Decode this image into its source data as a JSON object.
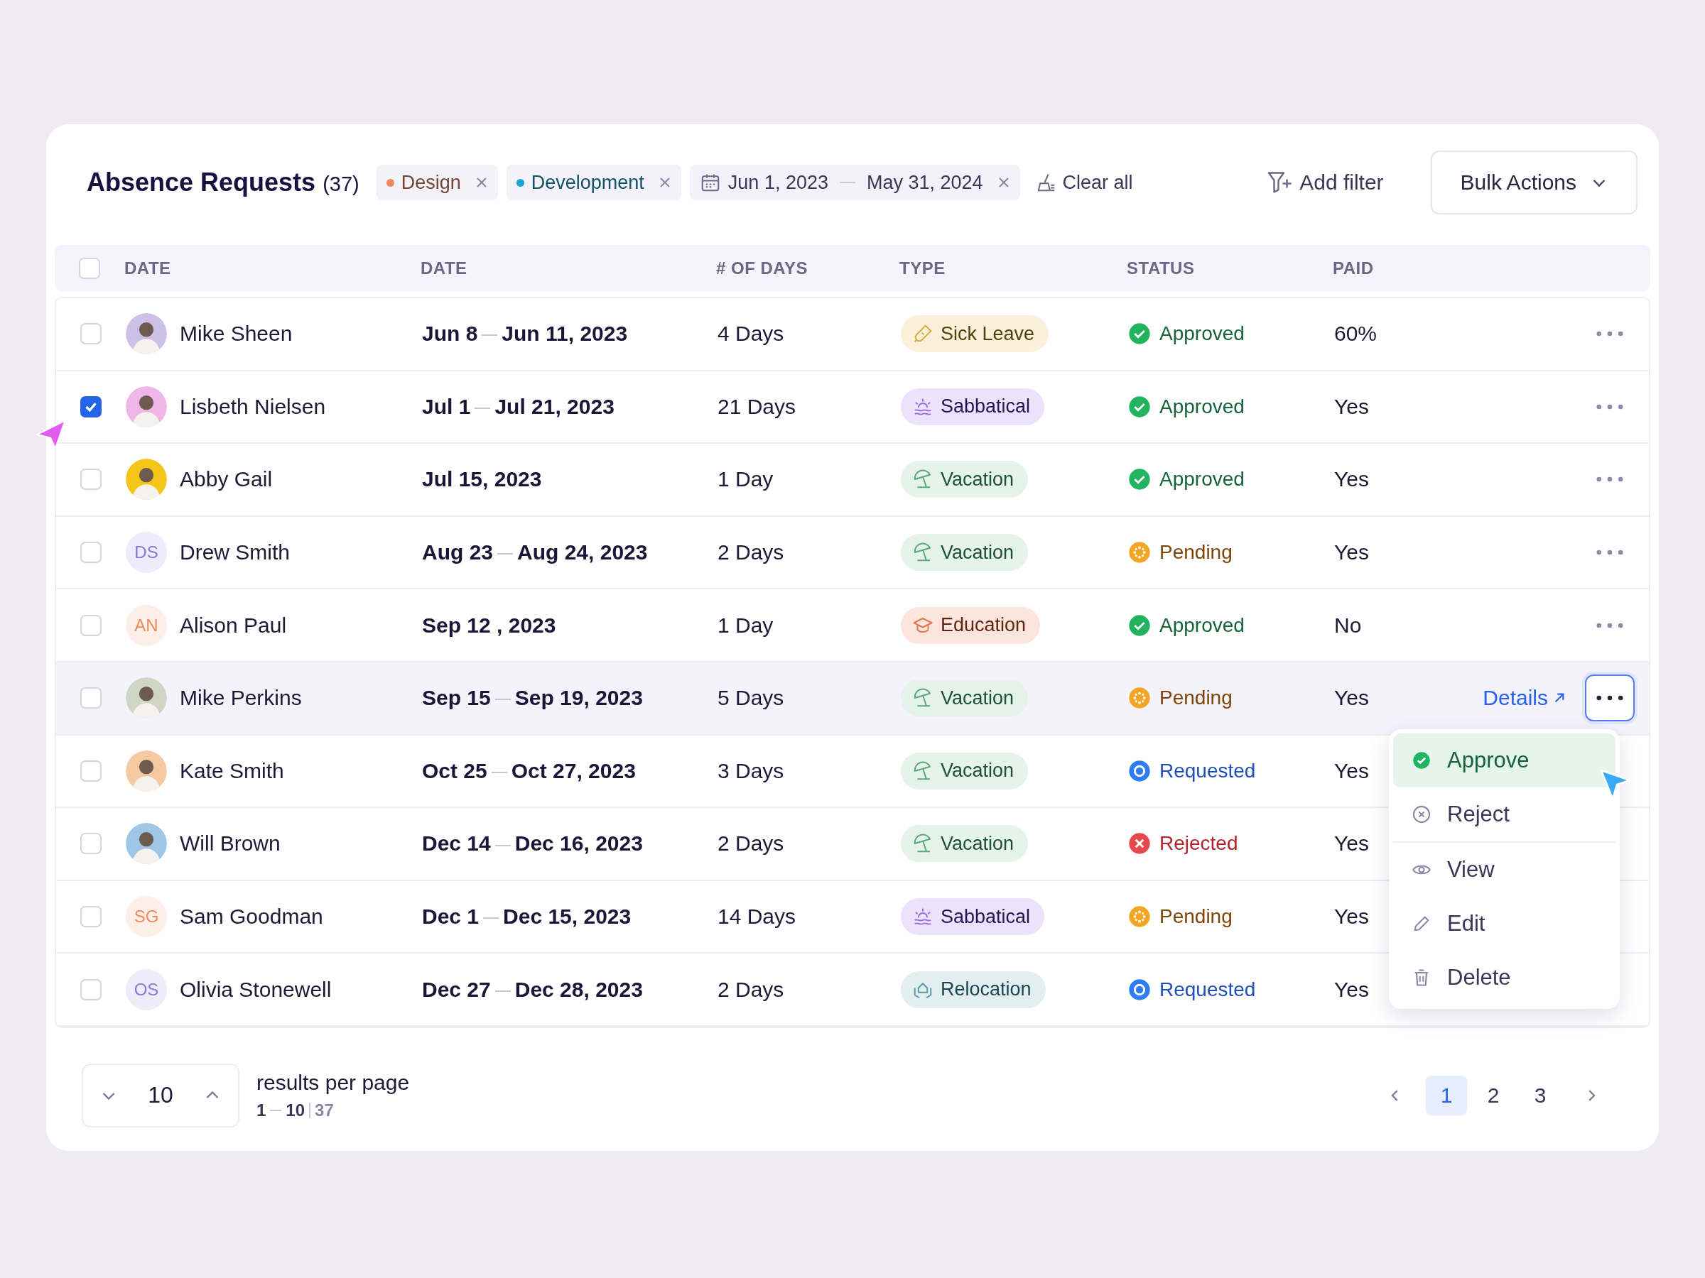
{
  "header": {
    "title": "Absence Requests",
    "count": "(37)"
  },
  "filters": [
    {
      "kind": "tag",
      "label": "Design",
      "color": "#f08a5d"
    },
    {
      "kind": "tag",
      "label": "Development",
      "color": "#1aa5d4"
    },
    {
      "kind": "date",
      "from": "Jun 1, 2023",
      "to": "May 31, 2024"
    }
  ],
  "clear_all": "Clear all",
  "add_filter": "Add filter",
  "bulk_actions": "Bulk Actions",
  "table": {
    "select_all": false,
    "columns": [
      "DATE",
      "DATE",
      "# OF DAYS",
      "TYPE",
      "STATUS",
      "PAID"
    ],
    "rows": [
      {
        "checked": false,
        "highlighted": false,
        "avatar": {
          "kind": "photo",
          "color": "#cdbfe6"
        },
        "name": "Mike Sheen",
        "date": {
          "from": "Jun 8",
          "to": "Jun 11, 2023"
        },
        "days": "4 Days",
        "type": {
          "kind": "sick",
          "label": "Sick Leave"
        },
        "status": {
          "kind": "approved",
          "label": "Approved"
        },
        "paid": "60%",
        "more_button": true
      },
      {
        "checked": true,
        "highlighted": false,
        "avatar": {
          "kind": "photo",
          "color": "#efb6e8"
        },
        "name": "Lisbeth Nielsen",
        "date": {
          "from": "Jul 1",
          "to": "Jul 21, 2023"
        },
        "days": "21 Days",
        "type": {
          "kind": "sabbatical",
          "label": "Sabbatical"
        },
        "status": {
          "kind": "approved",
          "label": "Approved"
        },
        "paid": "Yes",
        "more_button": true
      },
      {
        "checked": false,
        "highlighted": false,
        "avatar": {
          "kind": "photo",
          "color": "#f5c518"
        },
        "name": "Abby Gail",
        "date": {
          "from": "Jul 15, 2023"
        },
        "days": "1 Day",
        "type": {
          "kind": "vacation",
          "label": "Vacation"
        },
        "status": {
          "kind": "approved",
          "label": "Approved"
        },
        "paid": "Yes",
        "more_button": true
      },
      {
        "checked": false,
        "highlighted": false,
        "avatar": {
          "kind": "initials",
          "initials": "DS",
          "color": "#8677d9"
        },
        "name": "Drew Smith",
        "date": {
          "from": "Aug 23",
          "to": "Aug 24, 2023"
        },
        "days": "2 Days",
        "type": {
          "kind": "vacation",
          "label": "Vacation"
        },
        "status": {
          "kind": "pending",
          "label": "Pending"
        },
        "paid": "Yes",
        "more_button": true
      },
      {
        "checked": false,
        "highlighted": false,
        "avatar": {
          "kind": "initials",
          "initials": "AN",
          "color": "#ef8a5a"
        },
        "name": "Alison Paul",
        "date": {
          "from": "Sep 12 , 2023"
        },
        "days": "1 Day",
        "type": {
          "kind": "education",
          "label": "Education"
        },
        "status": {
          "kind": "approved",
          "label": "Approved"
        },
        "paid": "No",
        "more_button": true
      },
      {
        "checked": false,
        "highlighted": true,
        "avatar": {
          "kind": "photo",
          "color": "#cfd6c4"
        },
        "name": "Mike Perkins",
        "date": {
          "from": "Sep 15",
          "to": "Sep 19, 2023"
        },
        "days": "5 Days",
        "type": {
          "kind": "vacation",
          "label": "Vacation"
        },
        "status": {
          "kind": "pending",
          "label": "Pending"
        },
        "paid": "Yes",
        "details": "Details",
        "more_button": true
      },
      {
        "checked": false,
        "highlighted": false,
        "avatar": {
          "kind": "photo",
          "color": "#f6c9a0"
        },
        "name": "Kate Smith",
        "date": {
          "from": "Oct 25",
          "to": "Oct 27, 2023"
        },
        "days": "3 Days",
        "type": {
          "kind": "vacation",
          "label": "Vacation"
        },
        "status": {
          "kind": "requested",
          "label": "Requested"
        },
        "paid": "Yes",
        "more_button": false
      },
      {
        "checked": false,
        "highlighted": false,
        "avatar": {
          "kind": "photo",
          "color": "#9fc6e6"
        },
        "name": "Will Brown",
        "date": {
          "from": "Dec 14",
          "to": "Dec 16, 2023"
        },
        "days": "2 Days",
        "type": {
          "kind": "vacation",
          "label": "Vacation"
        },
        "status": {
          "kind": "rejected",
          "label": "Rejected"
        },
        "paid": "Yes",
        "more_button": false
      },
      {
        "checked": false,
        "highlighted": false,
        "avatar": {
          "kind": "initials",
          "initials": "SG",
          "color": "#ef8a5a"
        },
        "name": "Sam Goodman",
        "date": {
          "from": "Dec 1",
          "to": "Dec 15, 2023"
        },
        "days": "14 Days",
        "type": {
          "kind": "sabbatical",
          "label": "Sabbatical"
        },
        "status": {
          "kind": "pending",
          "label": "Pending"
        },
        "paid": "Yes",
        "more_button": false
      },
      {
        "checked": false,
        "highlighted": false,
        "avatar": {
          "kind": "initials",
          "initials": "OS",
          "color": "#8a7ad9"
        },
        "name": "Olivia Stonewell",
        "date": {
          "from": "Dec 27",
          "to": "Dec 28, 2023"
        },
        "days": "2 Days",
        "type": {
          "kind": "relocation",
          "label": "Relocation"
        },
        "status": {
          "kind": "requested",
          "label": "Requested"
        },
        "paid": "Yes",
        "more_button": false
      }
    ]
  },
  "menu": {
    "sections": [
      [
        {
          "kind": "approve",
          "label": "Approve",
          "selected": true
        },
        {
          "kind": "reject",
          "label": "Reject",
          "selected": false
        }
      ],
      [
        {
          "kind": "view",
          "label": "View",
          "selected": false
        },
        {
          "kind": "edit",
          "label": "Edit",
          "selected": false
        },
        {
          "kind": "delete",
          "label": "Delete",
          "selected": false
        }
      ]
    ]
  },
  "footer": {
    "per_page": "10",
    "per_page_label": "results per page",
    "range_from": "1",
    "range_to": "10",
    "total": "37"
  },
  "pagination": [
    {
      "label": "1",
      "selected": true
    },
    {
      "label": "2",
      "selected": false
    },
    {
      "label": "3",
      "selected": false
    }
  ]
}
